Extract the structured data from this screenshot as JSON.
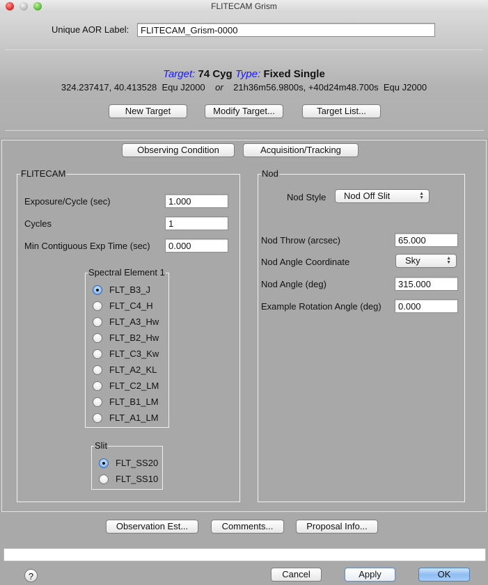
{
  "window": {
    "title": "FLITECAM Grism"
  },
  "aor": {
    "label": "Unique AOR Label:",
    "value": "FLITECAM_Grism-0000"
  },
  "target": {
    "target_key": "Target:",
    "target_name": "74 Cyg",
    "type_key": "Type:",
    "type_value": "Fixed Single",
    "coords_decimal": "324.237417, 40.413528  Equ J2000",
    "or": "or",
    "coords_sexagesimal": "21h36m56.9800s, +40d24m48.700s  Equ J2000",
    "accent_color": "#1a1aff",
    "buttons": {
      "new": "New Target",
      "modify": "Modify Target...",
      "list": "Target List..."
    }
  },
  "tabs": {
    "observing": "Observing Condition",
    "acquisition": "Acquisition/Tracking"
  },
  "flitecam": {
    "title": "FLITECAM",
    "exposure": {
      "label": "Exposure/Cycle (sec)",
      "value": "1.000"
    },
    "cycles": {
      "label": "Cycles",
      "value": "1"
    },
    "min_exp": {
      "label": "Min Contiguous Exp Time (sec)",
      "value": "0.000"
    },
    "spectral": {
      "title": "Spectral Element 1",
      "selected": "FLT_B3_J",
      "options": [
        "FLT_B3_J",
        "FLT_C4_H",
        "FLT_A3_Hw",
        "FLT_B2_Hw",
        "FLT_C3_Kw",
        "FLT_A2_KL",
        "FLT_C2_LM",
        "FLT_B1_LM",
        "FLT_A1_LM"
      ]
    },
    "slit": {
      "title": "Slit",
      "selected": "FLT_SS20",
      "options": [
        "FLT_SS20",
        "FLT_SS10"
      ]
    }
  },
  "nod": {
    "title": "Nod",
    "style": {
      "label": "Nod Style",
      "value": "Nod Off Slit"
    },
    "throw": {
      "label": "Nod Throw (arcsec)",
      "value": "65.000"
    },
    "coordinate": {
      "label": "Nod Angle Coordinate",
      "value": "Sky"
    },
    "angle": {
      "label": "Nod Angle (deg)",
      "value": "315.000"
    },
    "rotation": {
      "label": "Example Rotation Angle (deg)",
      "value": "0.000"
    }
  },
  "bottom": {
    "obs_est": "Observation Est...",
    "comments": "Comments...",
    "proposal": "Proposal Info...",
    "status_text": "",
    "help": "?",
    "cancel": "Cancel",
    "apply": "Apply",
    "ok": "OK"
  }
}
